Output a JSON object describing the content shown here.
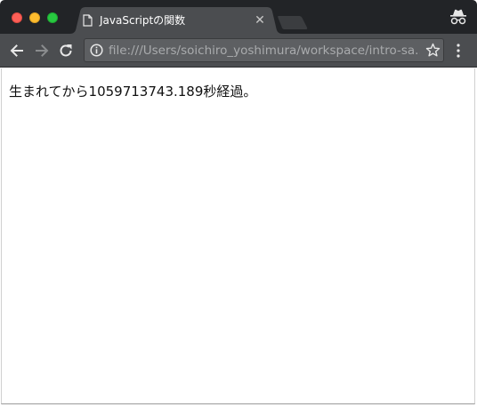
{
  "browser": {
    "tab": {
      "title": "JavaScriptの関数",
      "close_glyph": "✕"
    },
    "omnibox": {
      "url": "file:///Users/soichiro_yoshimura/workspace/intro-sa..."
    },
    "colors": {
      "tabstrip": "#222427",
      "toolbar": "#4b4d50",
      "omnibox": "#5d5f62"
    },
    "icons": [
      "page-icon",
      "close-icon",
      "incognito-icon",
      "back-arrow-icon",
      "forward-arrow-icon",
      "reload-icon",
      "info-icon",
      "star-icon",
      "menu-icon"
    ]
  },
  "page": {
    "message": "生まれてから1059713743.189秒経過。"
  }
}
